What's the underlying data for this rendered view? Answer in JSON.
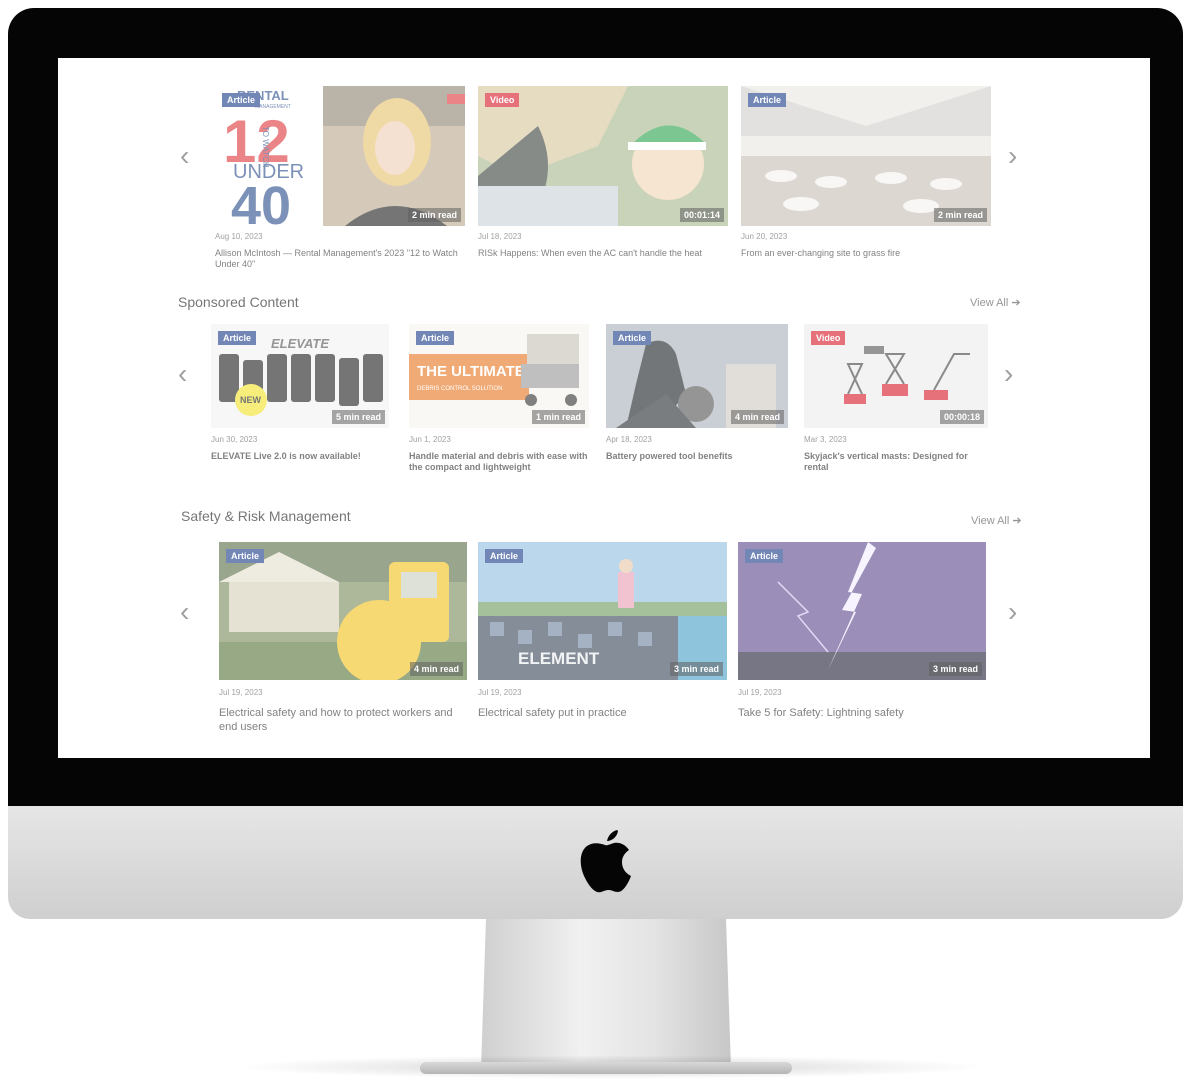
{
  "row1": {
    "cards": [
      {
        "badge": "Article",
        "badge_type": "article",
        "read": "2 min read",
        "date": "Aug 10, 2023",
        "title": "Allison McIntosh — Rental Management's 2023 \"12 to Watch Under 40\"",
        "art": {
          "brand": "RENTAL",
          "sub": "MANAGEMENT",
          "n12": "12",
          "side": "TO WATCH",
          "under": "UNDER",
          "n40": "40"
        }
      },
      {
        "badge": "Video",
        "badge_type": "video",
        "read": "00:01:14",
        "date": "Jul 18, 2023",
        "title": "RISk Happens: When even the AC can't handle the heat"
      },
      {
        "badge": "Article",
        "badge_type": "article",
        "read": "2 min read",
        "date": "Jun 20, 2023",
        "title": "From an ever-changing site to grass fire"
      }
    ]
  },
  "sponsored": {
    "heading": "Sponsored Content",
    "view_all": "View All",
    "cards": [
      {
        "badge": "Article",
        "badge_type": "article",
        "read": "5 min read",
        "date": "Jun 30, 2023",
        "title": "ELEVATE Live 2.0 is now available!",
        "art": {
          "logo": "ELEVATE",
          "new": "NEW"
        }
      },
      {
        "badge": "Article",
        "badge_type": "article",
        "read": "1 min read",
        "date": "Jun 1, 2023",
        "title": "Handle material and debris with ease with the compact and lightweight",
        "art": {
          "headline": "THE ULTIMATE",
          "sub": "DEBRIS CONTROL SOLUTION"
        }
      },
      {
        "badge": "Article",
        "badge_type": "article",
        "read": "4 min read",
        "date": "Apr 18, 2023",
        "title": "Battery powered tool benefits"
      },
      {
        "badge": "Video",
        "badge_type": "video",
        "read": "00:00:18",
        "date": "Mar 3, 2023",
        "title": "Skyjack's vertical masts: Designed for rental"
      }
    ]
  },
  "safety": {
    "heading": "Safety & Risk Management",
    "view_all": "View All",
    "cards": [
      {
        "badge": "Article",
        "badge_type": "article",
        "read": "4 min read",
        "date": "Jul 19, 2023",
        "title": "Electrical safety and how to protect workers and end users"
      },
      {
        "badge": "Article",
        "badge_type": "article",
        "read": "3 min read",
        "date": "Jul 19, 2023",
        "title": "Electrical safety put in practice",
        "art": {
          "truck_text": "ELEMENT"
        }
      },
      {
        "badge": "Article",
        "badge_type": "article",
        "read": "3 min read",
        "date": "Jul 19, 2023",
        "title": "Take 5 for Safety: Lightning safety"
      }
    ]
  },
  "nav": {
    "prev": "‹",
    "next": "›"
  },
  "colors": {
    "article_badge": "#1d3e8a",
    "video_badge": "#d81b2c",
    "brand_red": "#e03a3e",
    "brand_blue": "#2c4f8c"
  },
  "icons": {
    "apple": "apple-logo-icon",
    "arrow_right": "arrow-right-icon",
    "chevron_left": "chevron-left-icon",
    "chevron_right": "chevron-right-icon"
  }
}
